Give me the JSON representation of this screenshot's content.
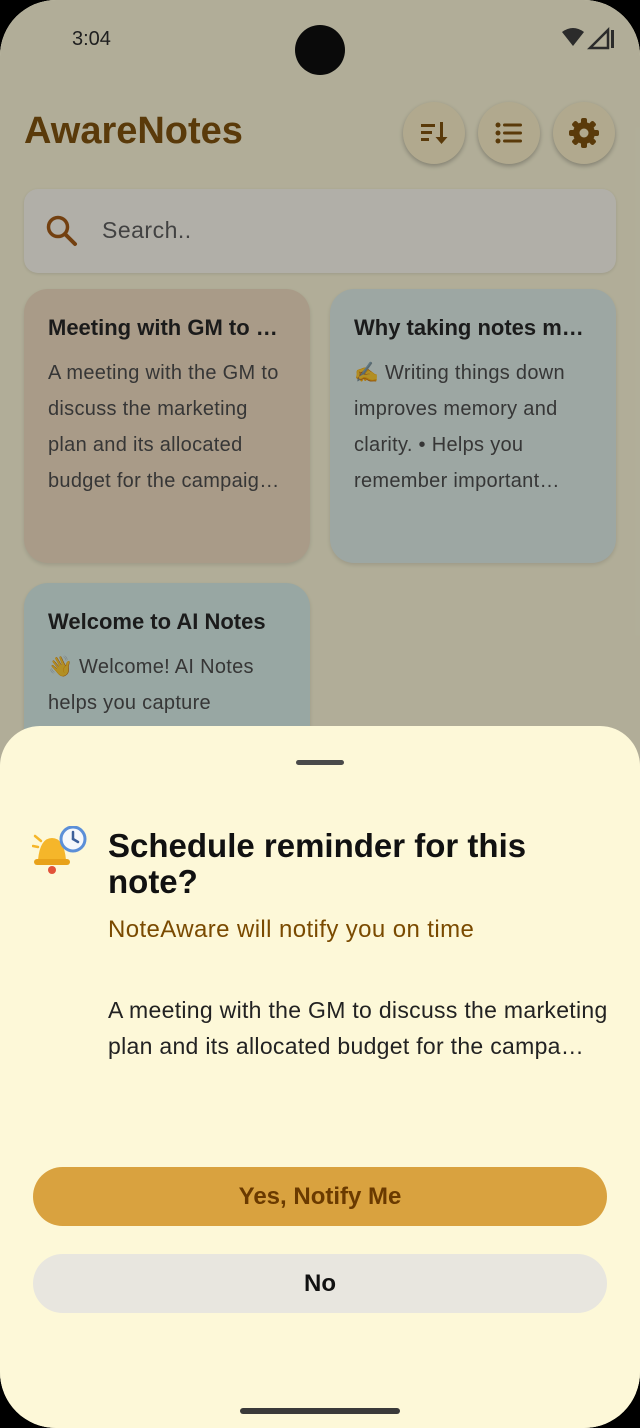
{
  "status_bar": {
    "time": "3:04"
  },
  "header": {
    "title": "AwareNotes"
  },
  "search": {
    "placeholder": "Search.."
  },
  "notes": [
    {
      "title": "Meeting with GM to discuss the marketing plan",
      "body": "A meeting with the GM to discuss the marketing plan and its allocated budget for the campaign in the first quarter"
    },
    {
      "title": "Why taking notes matters",
      "body": "✍️ Writing things down improves memory and clarity. • Helps you remember important details • Organizes your thoughts"
    },
    {
      "title": "Welcome to AI Notes",
      "body": "👋 Welcome! AI Notes helps you capture"
    }
  ],
  "reminder_sheet": {
    "title": "Schedule reminder for this note?",
    "subtitle": "NoteAware will notify you on time",
    "preview": "A meeting with the GM to discuss the marketing plan and its allocated budget for the campa…",
    "yes_label": "Yes, Notify Me",
    "no_label": "No"
  },
  "icons": {
    "sort": "sort-icon",
    "list": "list-icon",
    "settings": "gear-icon",
    "search": "search-icon",
    "reminder": "bell-clock-icon"
  },
  "colors": {
    "brand": "#7a4a00",
    "primary_button": "#d9a23f",
    "background": "#fdf8d8"
  }
}
